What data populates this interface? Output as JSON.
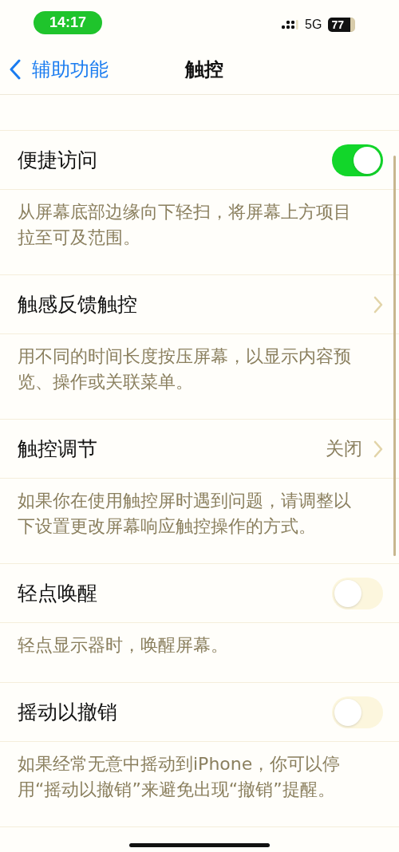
{
  "status_bar": {
    "time": "14:17",
    "network": "5G",
    "battery": "77"
  },
  "nav": {
    "back": "辅助功能",
    "title": "触控"
  },
  "rows": [
    {
      "kind": "toggle",
      "label": "便捷访问",
      "on": true,
      "footer": "从屏幕底部边缘向下轻扫，将屏幕上方项目拉至可及范围。"
    },
    {
      "kind": "link",
      "label": "触感反馈触控",
      "footer": "用不同的时间长度按压屏幕，以显示内容预览、操作或关联菜单。"
    },
    {
      "kind": "link",
      "label": "触控调节",
      "value": "关闭",
      "footer": "如果你在使用触控屏时遇到问题，请调整以下设置更改屏幕响应触控操作的方式。"
    },
    {
      "kind": "toggle",
      "label": "轻点唤醒",
      "on": false,
      "footer": "轻点显示器时，唤醒屏幕。"
    },
    {
      "kind": "toggle",
      "label": "摇动以撤销",
      "on": false,
      "footer": "如果经常无意中摇动到iPhone，你可以停用“摇动以撤销”来避免出现“撤销”提醒。"
    }
  ]
}
